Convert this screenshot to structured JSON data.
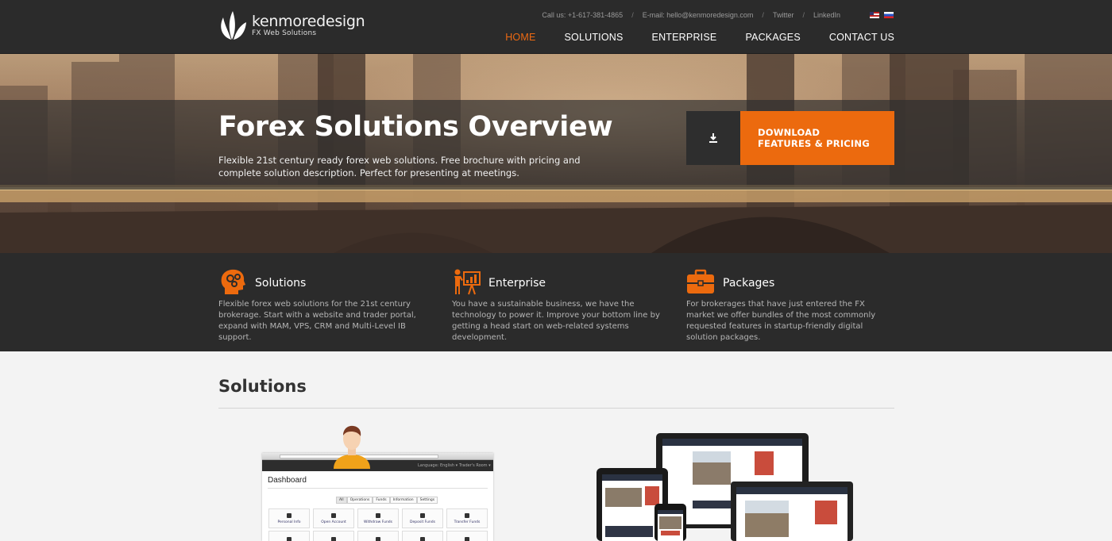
{
  "brand": {
    "name": "kenmoredesign",
    "tagline": "FX Web Solutions"
  },
  "topbar": {
    "phone": "Call us: +1-617-381-4865",
    "email": "E-mail: hello@kenmoredesign.com",
    "twitter": "Twitter",
    "linkedin": "LinkedIn",
    "separator": "/",
    "languages": [
      "en-flag",
      "ru-flag"
    ]
  },
  "nav": [
    {
      "label": "HOME",
      "active": true
    },
    {
      "label": "SOLUTIONS"
    },
    {
      "label": "ENTERPRISE"
    },
    {
      "label": "PACKAGES"
    },
    {
      "label": "CONTACT US"
    }
  ],
  "hero": {
    "title": "Forex Solutions Overview",
    "description": "Flexible 21st century ready forex web solutions. Free brochure with pricing and complete solution description. Perfect for presenting at meetings.",
    "download_line1": "DOWNLOAD",
    "download_line2": "FEATURES & PRICING",
    "download_icon": "download-icon"
  },
  "features": [
    {
      "title": "Solutions",
      "icon": "head-gears-icon",
      "desc": "Flexible forex web solutions for the 21st century brokerage. Start with a website and trader portal, expand with MAM, VPS, CRM and Multi-Level IB support."
    },
    {
      "title": "Enterprise",
      "icon": "presenter-chart-icon",
      "desc": "You have a sustainable business, we have the technology to power it. Improve your bottom line by getting a head start on web-related systems development."
    },
    {
      "title": "Packages",
      "icon": "briefcase-icon",
      "desc": "For brokerages that have just entered the FX market we offer bundles of the most commonly requested features in startup-friendly digital solution packages."
    }
  ],
  "solutions": {
    "title": "Solutions",
    "dashboard": {
      "title": "Dashboard",
      "language": "Language: English ▾",
      "room": "Trader's Room ▾",
      "tabs": [
        "All",
        "Operations",
        "Funds",
        "Information",
        "Settings"
      ],
      "tiles": [
        "Personal Info",
        "Open Account",
        "Withdraw Funds",
        "Deposit Funds",
        "Transfer Funds"
      ]
    }
  },
  "colors": {
    "accent": "#ec6a0e",
    "header_bg": "#2b2b2b",
    "page_bg": "#f3f3f3"
  }
}
